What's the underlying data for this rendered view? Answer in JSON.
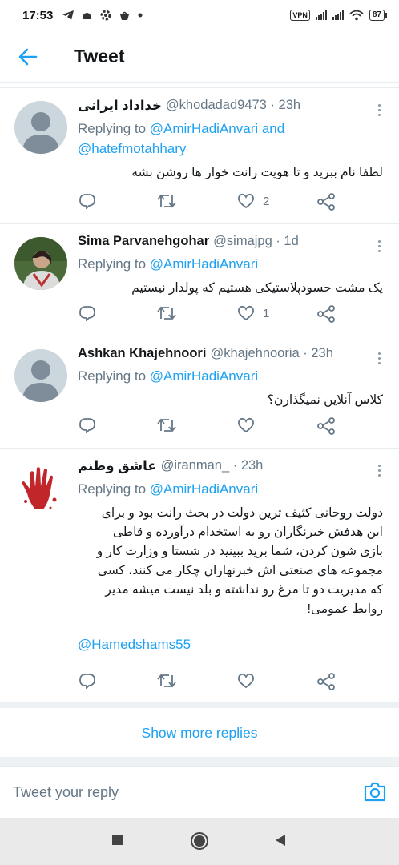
{
  "status_bar": {
    "time": "17:53",
    "left_icons": [
      "telegram-icon",
      "android-icon",
      "settings-icon",
      "bag-icon",
      "dot-icon"
    ],
    "vpn_label": "VPN",
    "battery": "87"
  },
  "header": {
    "title": "Tweet",
    "back_icon": "arrow-left-icon",
    "accent": "#1da1f2"
  },
  "tweets": [
    {
      "name": "خداداد ایرانی",
      "handle": "@khodadad9473 · 23h",
      "replying_prefix": "Replying to ",
      "replying_to": "@AmirHadiAnvari and",
      "replying_to_2": "@hatefmotahhary",
      "text": "لطفا نام ببرید و تا هویت رانت خوار ها روشن بشه",
      "likes": "2",
      "avatar": "default-avatar"
    },
    {
      "name": "Sima Parvanehgohar",
      "handle": "@simajpg · 1d",
      "replying_prefix": "Replying to ",
      "replying_to": "@AmirHadiAnvari",
      "text": "یک مشت حسودپلاستیکی هستیم که پولدار نیستیم",
      "likes": "1",
      "avatar": "photo-avatar"
    },
    {
      "name": "Ashkan Khajehnoori",
      "handle": "@khajehnooria · 23h",
      "replying_prefix": "Replying to ",
      "replying_to": "@AmirHadiAnvari",
      "text": "کلاس آنلاین نمیگذارن؟",
      "likes": "",
      "avatar": "default-avatar"
    },
    {
      "name": "عاشق وطنم",
      "handle": "@iranman_ · 23h",
      "replying_prefix": "Replying to ",
      "replying_to": "@AmirHadiAnvari",
      "text_lines": [
        "دولت روحانی کثیف ترین دولت در بحث رانت بود و برای",
        "این هدفش خبرنگاران رو به استخدام درآورده و قاطی",
        "بازی شون کردن، شما برید ببینید در شستا و وزارت کار و",
        "مجموعه های صنعتی اش خبرنهاران چکار می کنند، کسی",
        "که مدیریت دو تا مرغ رو نداشته و بلد نیست میشه مدیر",
        "روابط عمومی!"
      ],
      "mention": "@Hamedshams55",
      "likes": "",
      "avatar": "red-hand-avatar"
    }
  ],
  "show_more": "Show more replies",
  "reply_placeholder": "Tweet your reply",
  "camera_icon": "camera-icon",
  "nav_buttons": [
    "square-icon",
    "circle-icon",
    "back-triangle-icon"
  ]
}
